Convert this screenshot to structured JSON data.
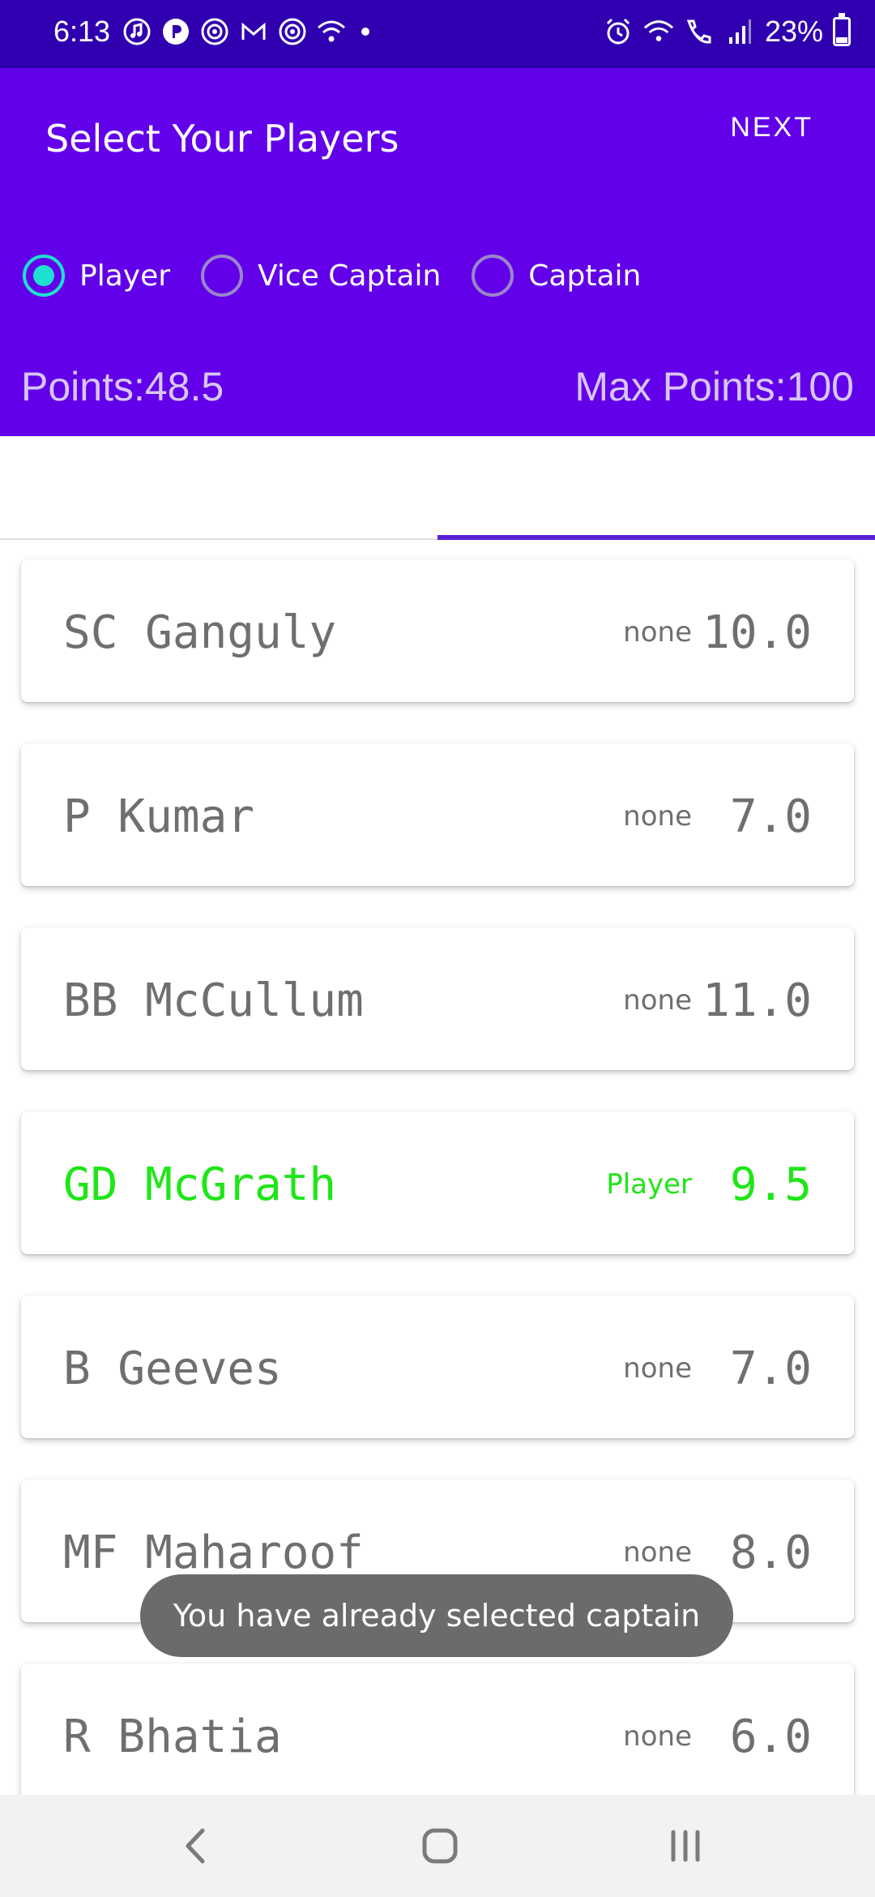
{
  "status_bar": {
    "time": "6:13",
    "battery": "23%",
    "battery_level": 0.23,
    "left_icons": [
      "music-icon",
      "p-badge-icon",
      "sync-icon",
      "gmail-icon",
      "sync-icon",
      "wifi-icon",
      "dot-icon"
    ],
    "right_icons": [
      "alarm-icon",
      "wifi-signal-icon",
      "wifi-calling-icon",
      "cell-signal-icon",
      "battery-icon"
    ]
  },
  "header": {
    "title": "Select Your Players",
    "next_label": "NEXT",
    "radio_options": [
      {
        "label": "Player",
        "checked": true
      },
      {
        "label": "Vice Captain",
        "checked": false
      },
      {
        "label": "Captain",
        "checked": false
      }
    ],
    "points_label": "Points:48.5",
    "max_points_label": "Max Points:100"
  },
  "players": [
    {
      "name": "SC Ganguly",
      "role": "none",
      "score": "10.0",
      "selected": false
    },
    {
      "name": "P Kumar",
      "role": "none",
      "score": "7.0",
      "selected": false
    },
    {
      "name": "BB McCullum",
      "role": "none",
      "score": "11.0",
      "selected": false
    },
    {
      "name": "GD McGrath",
      "role": "Player",
      "score": "9.5",
      "selected": true
    },
    {
      "name": "B Geeves",
      "role": "none",
      "score": "7.0",
      "selected": false
    },
    {
      "name": "MF Maharoof",
      "role": "none",
      "score": "8.0",
      "selected": false
    },
    {
      "name": "R Bhatia",
      "role": "none",
      "score": "6.0",
      "selected": false
    }
  ],
  "toast": "You have already selected captain",
  "colors": {
    "status_bar": "#3000b0",
    "header": "#6200ea",
    "radio_accent": "#1ee0d0",
    "selected_text": "#1ee617",
    "tab_indicator": "#5a1fd6"
  }
}
